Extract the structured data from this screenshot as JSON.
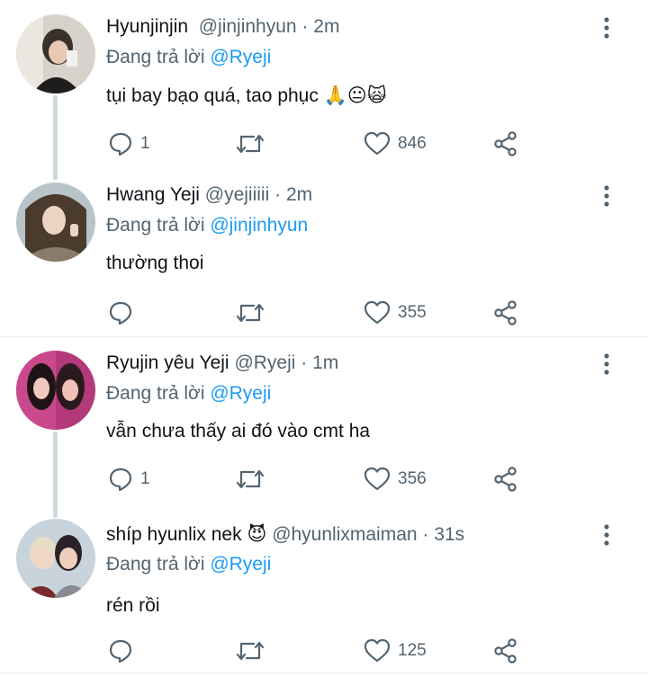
{
  "tweets": [
    {
      "name": "Hyunjinjin",
      "handle": "@jinjinhyun",
      "sep": "·",
      "time": "2m",
      "reply_prefix": "Đang trả lời",
      "reply_to": "@Ryeji",
      "text": "tụi bay bạo quá, tao phục",
      "emojis": [
        "🙏",
        "😐",
        "🙀"
      ],
      "replies": "1",
      "retweets": "",
      "likes": "846"
    },
    {
      "name": "Hwang Yeji",
      "handle": "@yejiiiii",
      "sep": "·",
      "time": "2m",
      "reply_prefix": "Đang trả lời",
      "reply_to": "@jinjinhyun",
      "text": "thường thoi",
      "replies": "",
      "retweets": "",
      "likes": "355"
    },
    {
      "name": "Ryujin yêu Yeji",
      "handle": "@Ryeji",
      "sep": "·",
      "time": "1m",
      "reply_prefix": "Đang trả lời",
      "reply_to": "@Ryeji",
      "text": "vẫn chưa thấy ai đó vào cmt ha",
      "replies": "1",
      "retweets": "",
      "likes": "356"
    },
    {
      "name": "shíp hyunlix nek",
      "name_emoji": "😈",
      "handle": "@hyunlixmaiman",
      "sep": "·",
      "time": "31s",
      "reply_prefix": "Đang trả lời",
      "reply_to": "@Ryeji",
      "text": "rén rồi",
      "replies": "",
      "retweets": "",
      "likes": "125"
    }
  ],
  "icons": [
    "reply-icon",
    "retweet-icon",
    "like-icon",
    "share-icon",
    "more-icon"
  ],
  "colors": {
    "mention": "#1d9bf0",
    "muted": "#536471",
    "thread": "#cfd9de"
  }
}
